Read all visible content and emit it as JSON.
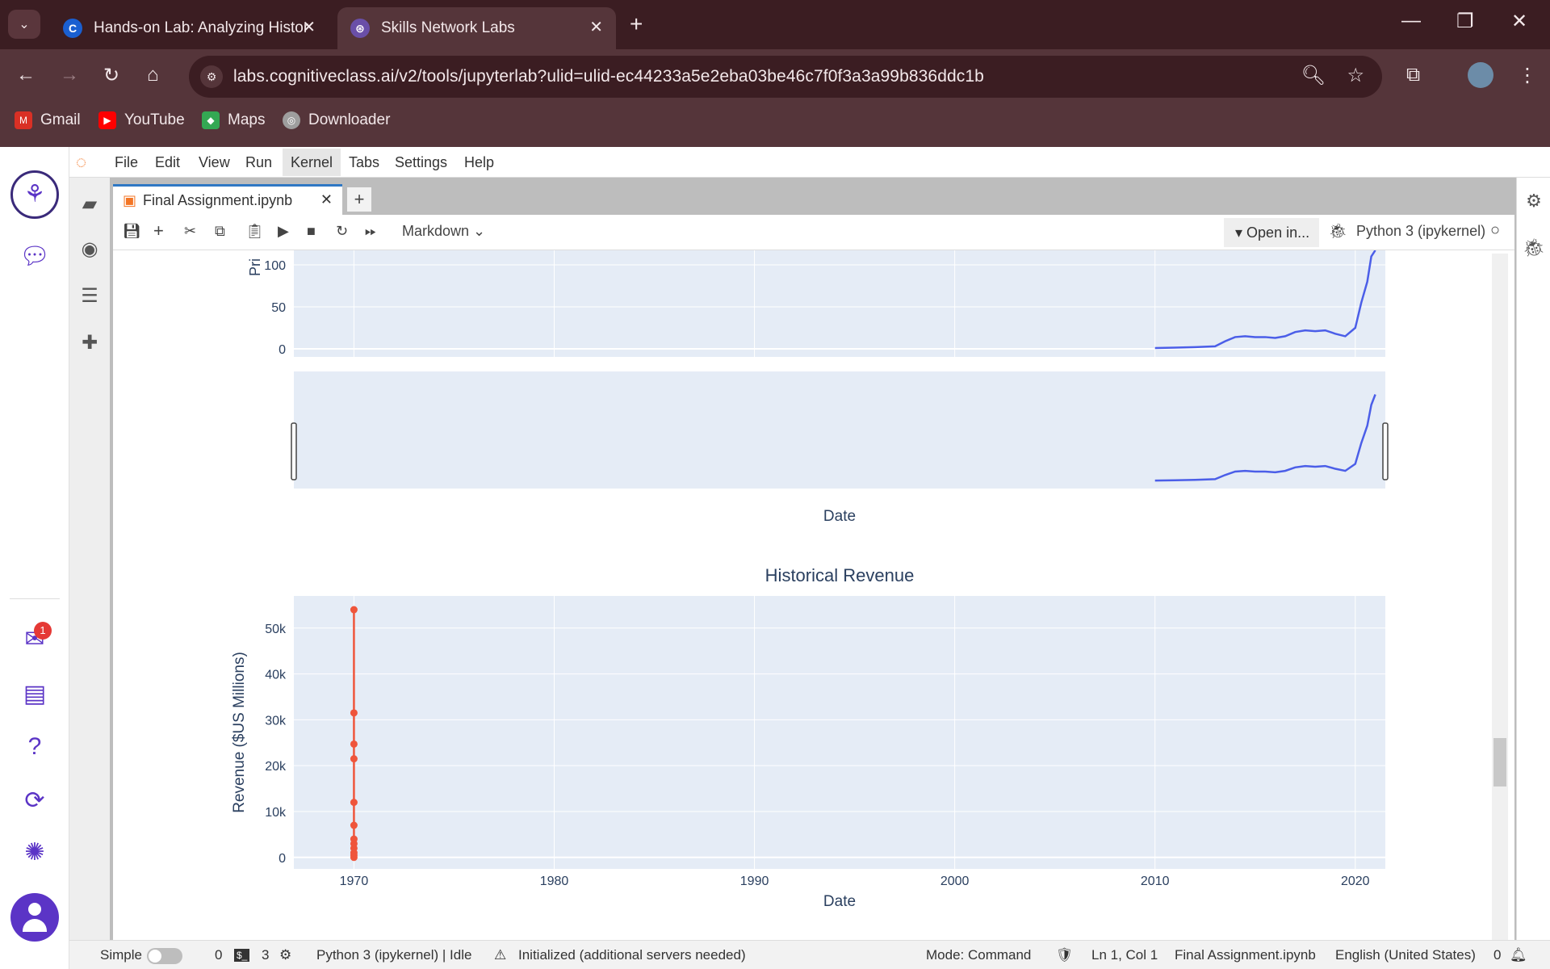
{
  "browser": {
    "tabs": [
      {
        "title": "Hands-on Lab: Analyzing Histor",
        "active": false
      },
      {
        "title": "Skills Network Labs",
        "active": true
      }
    ],
    "url": "labs.cognitiveclass.ai/v2/tools/jupyterlab?ulid=ulid-ec44233a5e2eba03be46c7f0f3a3a99b836ddc1b",
    "bookmarks": [
      "Gmail",
      "YouTube",
      "Maps",
      "Downloader"
    ]
  },
  "jupyter": {
    "menu": [
      "File",
      "Edit",
      "View",
      "Run",
      "Kernel",
      "Tabs",
      "Settings",
      "Help"
    ],
    "active_menu": "Kernel",
    "doc_tab": "Final Assignment.ipynb",
    "cell_type": "Markdown",
    "open_in": "Open in...",
    "kernel": "Python 3 (ipykernel)",
    "notification_count": "1"
  },
  "status": {
    "mode_label": "Simple",
    "terminals": "0",
    "kernels": "3",
    "kernel_status": "Python 3 (ipykernel) | Idle",
    "lsp": "Initialized (additional servers needed)",
    "mode": "Mode: Command",
    "cursor": "Ln 1, Col 1",
    "file": "Final Assignment.ipynb",
    "language": "English (United States)",
    "notifications": "0"
  },
  "chart_data": [
    {
      "type": "line",
      "title": "",
      "xlabel": "Date",
      "ylabel": "Pri",
      "ytick_labels": [
        "0",
        "50",
        "100"
      ],
      "series": [
        {
          "x": [
            "2010-06",
            "2011",
            "2012",
            "2013",
            "2013.5",
            "2014",
            "2014.5",
            "2015",
            "2015.5",
            "2016",
            "2016.5",
            "2017",
            "2017.5",
            "2018",
            "2018.5",
            "2019",
            "2019.5",
            "2020",
            "2020.3",
            "2020.6",
            "2020.8",
            "2021"
          ],
          "y": [
            1,
            1.5,
            2,
            3,
            9,
            14,
            15,
            14,
            14,
            13,
            15,
            20,
            22,
            21,
            22,
            18,
            15,
            25,
            55,
            80,
            110,
            125
          ]
        }
      ],
      "color": "#4b5ee8"
    },
    {
      "type": "line",
      "title": "Historical Revenue",
      "xlabel": "Date",
      "ylabel": "Revenue ($US Millions)",
      "xtick_labels": [
        "1970",
        "1980",
        "1990",
        "2000",
        "2010",
        "2020"
      ],
      "ytick_labels": [
        "0",
        "10k",
        "20k",
        "30k",
        "40k",
        "50k"
      ],
      "xlim": [
        1967,
        2021.5
      ],
      "ylim": [
        -2500,
        57000
      ],
      "series": [
        {
          "x": [
            1970,
            1970,
            1970,
            1970,
            1970,
            1970,
            1970,
            1970,
            1970,
            1970,
            1970,
            1970
          ],
          "y": [
            0,
            500,
            1000,
            2000,
            3000,
            4000,
            7000,
            12000,
            21500,
            24700,
            31500,
            54000
          ]
        }
      ],
      "color": "#ef553b"
    }
  ]
}
